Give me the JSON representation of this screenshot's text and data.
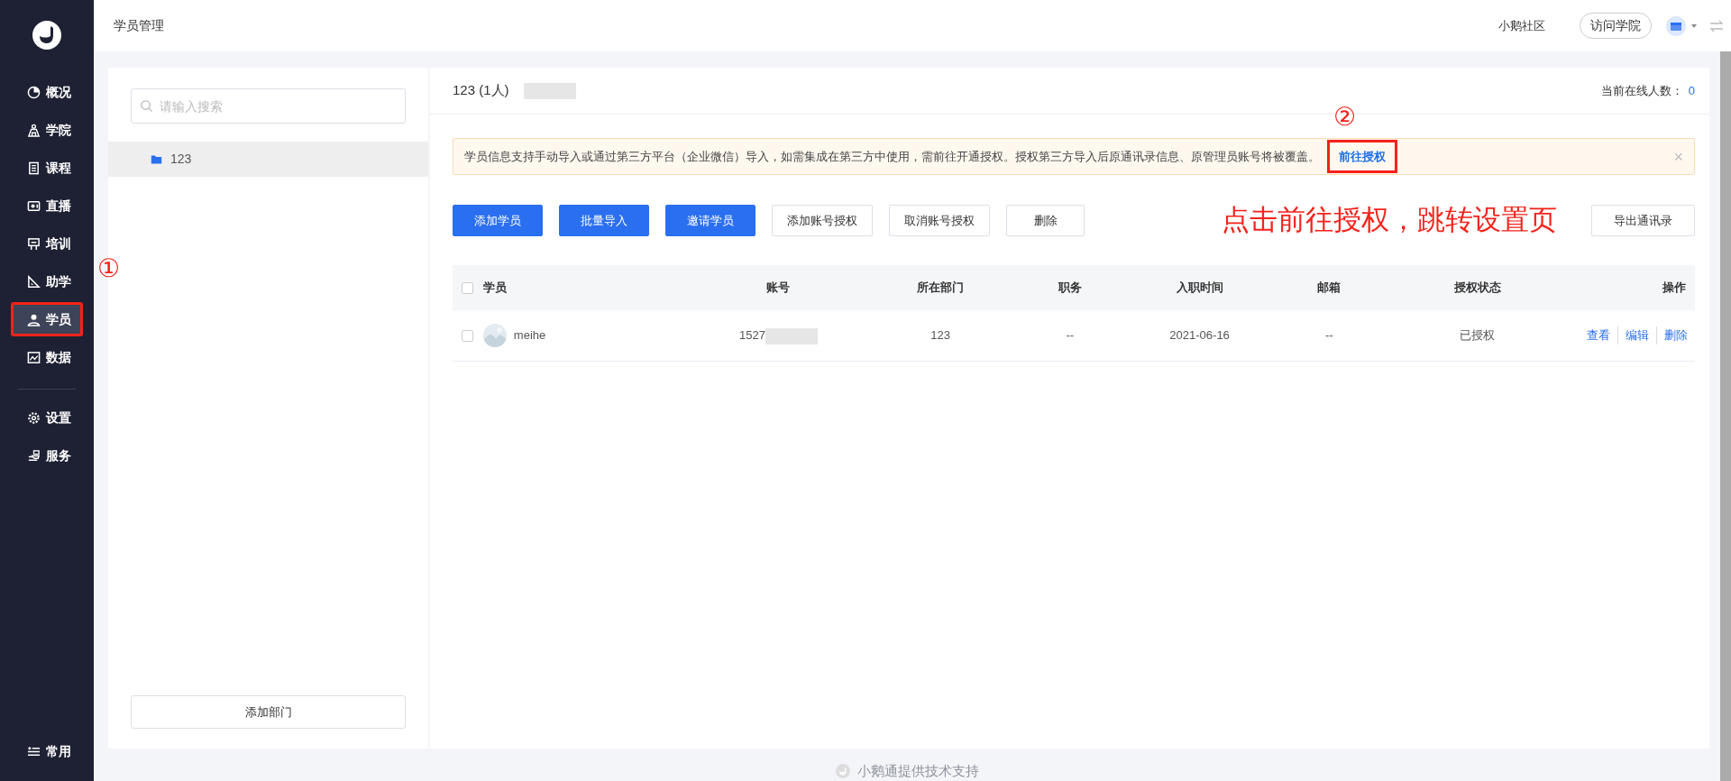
{
  "sidebar": {
    "items": [
      {
        "label": "概况",
        "selected": false,
        "highlighted": false
      },
      {
        "label": "学院",
        "selected": false,
        "highlighted": false
      },
      {
        "label": "课程",
        "selected": false,
        "highlighted": false
      },
      {
        "label": "直播",
        "selected": false,
        "highlighted": false
      },
      {
        "label": "培训",
        "selected": false,
        "highlighted": false
      },
      {
        "label": "助学",
        "selected": false,
        "highlighted": false
      },
      {
        "label": "学员",
        "selected": true,
        "highlighted": true
      },
      {
        "label": "数据",
        "selected": false,
        "highlighted": false
      },
      {
        "label": "设置",
        "selected": false,
        "highlighted": false,
        "group_start": true
      },
      {
        "label": "服务",
        "selected": false,
        "highlighted": false
      }
    ],
    "bottom_item": {
      "label": "常用"
    }
  },
  "header": {
    "title": "学员管理",
    "community_link": "小鹅社区",
    "visit_button": "访问学院"
  },
  "departments": {
    "search": {
      "placeholder": "请输入搜索"
    },
    "items": [
      {
        "label": "123",
        "selected": true
      }
    ],
    "add_button": "添加部门"
  },
  "main": {
    "heading": "123 (1人)",
    "online_label": "当前在线人数：",
    "online_count": "0",
    "alert": {
      "text": "学员信息支持手动导入或通过第三方平台（企业微信）导入，如需集成在第三方中使用，需前往开通授权。授权第三方导入后原通讯录信息、原管理员账号将被覆盖。",
      "link": "前往授权",
      "link_highlighted": true,
      "close": "×"
    },
    "buttons": [
      {
        "label": "添加学员",
        "kind": "primary"
      },
      {
        "label": "批量导入",
        "kind": "primary"
      },
      {
        "label": "邀请学员",
        "kind": "primary"
      },
      {
        "label": "添加账号授权",
        "kind": "outline"
      },
      {
        "label": "取消账号授权",
        "kind": "outline"
      },
      {
        "label": "删除",
        "kind": "outline"
      }
    ],
    "export_button": "导出通讯录",
    "table": {
      "header_checked": false,
      "columns": [
        "学员",
        "账号",
        "所在部门",
        "职务",
        "入职时间",
        "邮箱",
        "授权状态",
        "操作"
      ],
      "rows": [
        {
          "checked": false,
          "name": "meihe",
          "account": "1527",
          "department": "123",
          "position": "--",
          "joined": "2021-06-16",
          "email": "--",
          "status": "已授权",
          "actions": [
            "查看",
            "编辑",
            "删除"
          ]
        }
      ]
    }
  },
  "annotations": [
    {
      "kind": "step",
      "text": "①"
    },
    {
      "kind": "step",
      "text": "②"
    },
    {
      "kind": "note",
      "text": "点击前往授权，跳转设置页"
    }
  ],
  "footer": "小鹅通提供技术支持"
}
